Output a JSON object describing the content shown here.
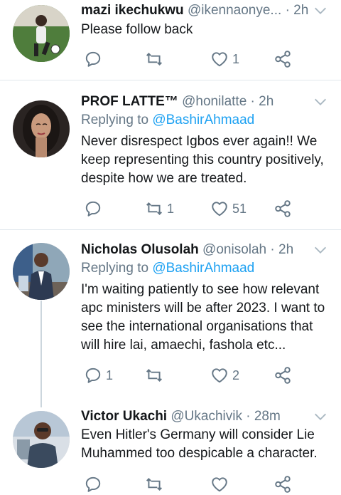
{
  "tweets": [
    {
      "name": "mazi ikechukwu",
      "handle": "@ikennaonye...",
      "time": "· 2h",
      "replying_prefix": "",
      "replying_to": "",
      "text": "Please follow back",
      "replies": "",
      "retweets": "",
      "likes": "1"
    },
    {
      "name": "PROF LATTE™",
      "handle": "@honilatte",
      "time": "· 2h",
      "replying_prefix": "Replying to ",
      "replying_to": "@BashirAhmaad",
      "text": "Never disrespect Igbos ever again!! We keep representing this country positively, despite how we are treated.",
      "replies": "",
      "retweets": "1",
      "likes": "51"
    },
    {
      "name": "Nicholas Olusolah",
      "handle": "@onisolah",
      "time": "· 2h",
      "replying_prefix": "Replying to ",
      "replying_to": "@BashirAhmaad",
      "text": "I'm waiting patiently to see how relevant apc ministers will be after 2023. I want to see the international organisations that will hire lai, amaechi, fashola etc...",
      "replies": "1",
      "retweets": "",
      "likes": "2"
    },
    {
      "name": "Victor Ukachi",
      "handle": "@Ukachivik",
      "time": "· 28m",
      "replying_prefix": "",
      "replying_to": "",
      "text": "Even Hitler's Germany will consider Lie Muhammed too despicable a character.",
      "replies": "",
      "retweets": "",
      "likes": ""
    }
  ],
  "colors": {
    "text": "#14171a",
    "muted": "#657786",
    "link": "#1da1f2",
    "separator": "#e1e8ed"
  },
  "icons": [
    "reply-icon",
    "retweet-icon",
    "like-icon",
    "share-icon",
    "chevron-down-icon"
  ]
}
